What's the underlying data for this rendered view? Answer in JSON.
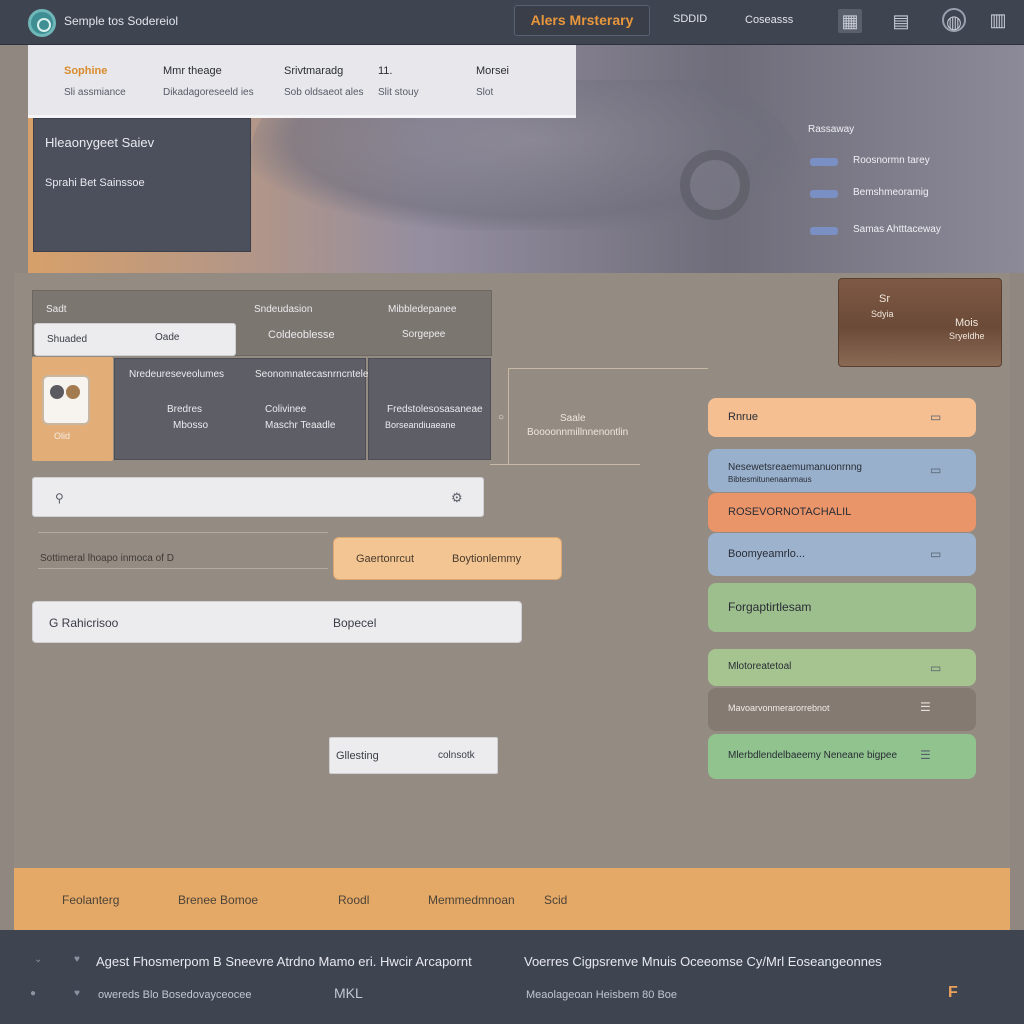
{
  "topbar": {
    "title": "Semple tos Sodereiol",
    "center_label": "Alers Mrsterary",
    "nav_1": "SDDID",
    "nav_2": "Coseasss",
    "nav_2_icon": "gear-icon"
  },
  "hero": {
    "tabs": [
      {
        "title": "Sophine",
        "sub": "Sli assmiance"
      },
      {
        "title": "Mmr theage",
        "sub": "Dikadagoreseeld ies"
      },
      {
        "title": "Srivtmaradg",
        "sub": "Sob oldsaeot ales"
      },
      {
        "title": "11.",
        "sub": "Slit stouy"
      },
      {
        "title": "Morsei",
        "sub": "Slot"
      }
    ],
    "panel_title": "Hleaonygeet Saiev",
    "panel_link": "Sprahi Bet Sainssoe",
    "right_title": "Rassaway",
    "right_items": [
      "Roosnormn tarey",
      "Bemshmeoramig",
      "Samas Ahtttaceway"
    ]
  },
  "main": {
    "form1_label": "Sadt",
    "form1_value": "Shuaded",
    "form1_opt": "Oade",
    "col2_head": "Sndeudasion",
    "col2_value": "Coldeoblesse",
    "col3_head": "Mibbledepanee",
    "col3_value": "Sorgepee",
    "promo_title": "Sr",
    "promo_line_1": "Sdyia",
    "promo_name": "Mois",
    "promo_sub": "Sryeldhe",
    "thumb_label": "Olid",
    "info_head_1": "Nredeureseveolumes",
    "info_head_2": "Seonomnatecasnrncnteles",
    "info_col1_1": "Bredres",
    "info_col1_2": "Mbosso",
    "info_col2_1": "Colivinee",
    "info_col2_2": "Maschr Teaadle",
    "info_col3_1": "Fredstolesosasaneae",
    "info_col3_2": "Borseandiuaeane",
    "connector_1": "Saale",
    "connector_2": "Boooonnmillnnenontlin",
    "search_text": "Sottimeral lhoapo inmoca of D",
    "btn_left": "Gaertonrcut",
    "btn_right": "Boytionlemmy",
    "field_left": "G Rahicrisoo",
    "field_right": "Bopecel",
    "small_btn_left": "Gllesting",
    "small_btn_right": "colnsotk",
    "pills": [
      {
        "label": "Rnrue",
        "color": "#f5bf92"
      },
      {
        "label": "Nesewetsreaemumanuonrnng",
        "sub": "Bibtesmitunenaanmaus",
        "color": "#98b0cc"
      },
      {
        "label": "ROSEVORNOTACHALIL",
        "color": "#ea946a"
      },
      {
        "label": "Boomyeamrlo...",
        "color": "#9cb2cd"
      },
      {
        "label": "Forgaptirtlesam",
        "color": "#9dbf8e"
      },
      {
        "label": "Mlotoreatetoal",
        "color": "#a6c490"
      },
      {
        "label": "Mavoarvonmerarorrebnot",
        "color": "#847a72"
      },
      {
        "label": "Mlerbdlendelbaeemy Neneane bigpee",
        "color": "#90c38e"
      }
    ]
  },
  "strip": {
    "items": [
      "Feolanterg",
      "Brenee Bomoe",
      "Roodl",
      "Memmedmnoan",
      "Scid"
    ]
  },
  "footer": {
    "line_left": "Agest Fhosmerpom B Sneevre Atrdno Mamo eri. Hwcir Arcapornt",
    "line_right": "Voerres Cigpsrenve Mnuis Oceeomse Cy/Mrl Eoseangeonnes",
    "sub_left": "owereds Blo Bosedovayceocee",
    "sub_mid": "MKL",
    "sub_right": "Meaolageoan Heisbem 80 Boe",
    "corner": "F"
  }
}
